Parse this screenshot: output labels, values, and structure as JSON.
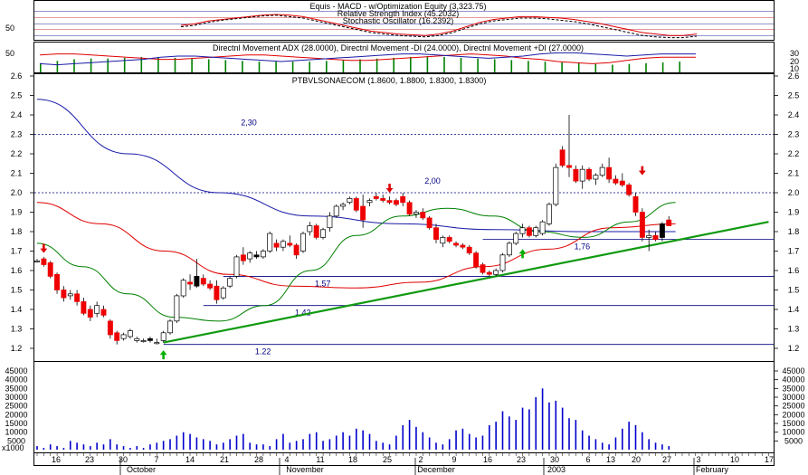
{
  "colors": {
    "frame": "#000000",
    "grid": "#b0b0b0",
    "up": "#ffffff",
    "down": "#ee0000",
    "black_candle": "#000000",
    "blue": "#000080",
    "blue_line": "#1a1aa8",
    "red": "#e00000",
    "green": "#008000",
    "trend_green": "#109a10",
    "volume": "#0000cc",
    "arrow_red": "#e00000",
    "arrow_green": "#00b000"
  },
  "panel_titles": {
    "p1_title1": "Equis - MACD - w/Optimization Equity (3,323.75)",
    "p1_title2": "Relative Strength Index (45.2032)",
    "p1_title3": "Stochastic Oscillator (16.2392)",
    "p2_title": "Directnl Movement ADX (28.0000), Directnl Movement -DI (24.0000), Directnl Movement +DI (27.0000)",
    "p3_title": "PTBVLSONAECOM (1.8600, 1.8800, 1.8300, 1.8300)"
  },
  "chart_data": [
    {
      "type": "line",
      "name_in_chart": "oscillators",
      "left_ticks": [
        "50"
      ],
      "series": [
        {
          "name": "Relative Strength Index",
          "style": "solid-red",
          "values": [
            50,
            52,
            56,
            58,
            60,
            62,
            64,
            65,
            64,
            62,
            58,
            54,
            50,
            46,
            42,
            40,
            38,
            37,
            36,
            38,
            42,
            48,
            54,
            58,
            60,
            62,
            62,
            61,
            60,
            58,
            55,
            52,
            48,
            44,
            40,
            38,
            36,
            36,
            38
          ]
        },
        {
          "name": "Stochastic Oscillator",
          "style": "dashed-black",
          "values": [
            48,
            50,
            54,
            57,
            59,
            61,
            63,
            64,
            62,
            60,
            56,
            52,
            48,
            44,
            40,
            38,
            36,
            35,
            34,
            36,
            40,
            46,
            52,
            56,
            58,
            60,
            60,
            59,
            57,
            55,
            52,
            48,
            44,
            40,
            36,
            34,
            33,
            33,
            35
          ]
        }
      ]
    },
    {
      "type": "bar+line",
      "name_in_chart": "directional-movement",
      "left_ticks": [
        "50"
      ],
      "right_ticks": [
        "30",
        "20",
        "10"
      ],
      "adx_bars": [
        12,
        15,
        17,
        18,
        18,
        19,
        20,
        20,
        19,
        18,
        17,
        16,
        15,
        14,
        14,
        14,
        14,
        15,
        16,
        17,
        18,
        19,
        20,
        21,
        20,
        19,
        18,
        17,
        16,
        15,
        14,
        13,
        12,
        11,
        10,
        11,
        12,
        13,
        14
      ],
      "series": [
        {
          "name": "Directnl Movement -DI",
          "values": [
            26,
            27,
            27,
            26,
            25,
            24,
            23,
            22,
            22,
            23,
            24,
            25,
            26,
            26,
            25,
            24,
            23,
            22,
            21,
            21,
            22,
            23,
            24,
            25,
            26,
            27,
            26,
            25,
            23,
            22,
            20,
            19,
            18,
            19,
            21,
            23,
            24,
            24,
            24
          ]
        },
        {
          "name": "Directnl Movement +DI",
          "values": [
            18,
            17,
            18,
            19,
            20,
            21,
            22,
            24,
            25,
            25,
            24,
            23,
            22,
            21,
            20,
            21,
            22,
            23,
            24,
            25,
            26,
            27,
            27,
            26,
            25,
            24,
            23,
            24,
            25,
            27,
            28,
            28,
            27,
            26,
            25,
            26,
            27,
            27,
            27
          ]
        }
      ]
    },
    {
      "type": "candlestick",
      "name_in_chart": "price",
      "ylim": [
        1.15,
        2.62
      ],
      "y_ticks": [
        "1.2",
        "1.3",
        "1.4",
        "1.5",
        "1.6",
        "1.7",
        "1.8",
        "1.9",
        "2.0",
        "2.1",
        "2.2",
        "2.3",
        "2.4",
        "2.5",
        "2.6"
      ],
      "x_ticks": [
        "16",
        "23",
        "30",
        "7",
        "14",
        "21",
        "28",
        "4",
        "11",
        "18",
        "25",
        "2",
        "9",
        "16",
        "23",
        "30",
        "6",
        "13",
        "20",
        "27",
        "3",
        "10",
        "17"
      ],
      "month_labels": [
        "October",
        "November",
        "December",
        "2003",
        "February"
      ],
      "candles": [
        [
          1.65,
          1.66,
          1.64,
          1.65
        ],
        [
          1.66,
          1.67,
          1.62,
          1.63
        ],
        [
          1.64,
          1.65,
          1.56,
          1.57
        ],
        [
          1.58,
          1.59,
          1.48,
          1.5
        ],
        [
          1.5,
          1.52,
          1.44,
          1.46
        ],
        [
          1.47,
          1.5,
          1.45,
          1.48
        ],
        [
          1.48,
          1.5,
          1.42,
          1.44
        ],
        [
          1.44,
          1.46,
          1.37,
          1.38
        ],
        [
          1.4,
          1.42,
          1.34,
          1.36
        ],
        [
          1.38,
          1.44,
          1.36,
          1.42
        ],
        [
          1.4,
          1.42,
          1.36,
          1.37
        ],
        [
          1.34,
          1.35,
          1.25,
          1.27
        ],
        [
          1.28,
          1.29,
          1.22,
          1.24
        ],
        [
          1.25,
          1.28,
          1.24,
          1.27
        ],
        [
          1.26,
          1.3,
          1.25,
          1.29
        ],
        [
          1.24,
          1.26,
          1.23,
          1.25
        ],
        [
          1.24,
          1.25,
          1.23,
          1.24
        ],
        [
          1.25,
          1.26,
          1.23,
          1.24
        ],
        [
          1.23,
          1.25,
          1.22,
          1.23
        ],
        [
          1.24,
          1.29,
          1.23,
          1.28
        ],
        [
          1.28,
          1.35,
          1.27,
          1.34
        ],
        [
          1.34,
          1.48,
          1.33,
          1.47
        ],
        [
          1.47,
          1.56,
          1.46,
          1.55
        ],
        [
          1.54,
          1.58,
          1.5,
          1.53
        ],
        [
          1.52,
          1.66,
          1.51,
          1.57
        ],
        [
          1.56,
          1.58,
          1.52,
          1.53
        ],
        [
          1.53,
          1.55,
          1.5,
          1.51
        ],
        [
          1.52,
          1.55,
          1.43,
          1.45
        ],
        [
          1.46,
          1.52,
          1.45,
          1.51
        ],
        [
          1.52,
          1.57,
          1.51,
          1.56
        ],
        [
          1.57,
          1.68,
          1.56,
          1.67
        ],
        [
          1.68,
          1.72,
          1.63,
          1.65
        ],
        [
          1.66,
          1.7,
          1.64,
          1.69
        ],
        [
          1.68,
          1.7,
          1.66,
          1.67
        ],
        [
          1.67,
          1.71,
          1.66,
          1.7
        ],
        [
          1.7,
          1.8,
          1.69,
          1.79
        ],
        [
          1.74,
          1.76,
          1.7,
          1.72
        ],
        [
          1.72,
          1.76,
          1.7,
          1.75
        ],
        [
          1.74,
          1.78,
          1.72,
          1.73
        ],
        [
          1.73,
          1.74,
          1.66,
          1.68
        ],
        [
          1.7,
          1.8,
          1.69,
          1.79
        ],
        [
          1.8,
          1.85,
          1.78,
          1.83
        ],
        [
          1.83,
          1.84,
          1.76,
          1.77
        ],
        [
          1.77,
          1.82,
          1.76,
          1.81
        ],
        [
          1.82,
          1.9,
          1.8,
          1.88
        ],
        [
          1.88,
          1.94,
          1.87,
          1.93
        ],
        [
          1.93,
          1.95,
          1.91,
          1.94
        ],
        [
          1.95,
          1.98,
          1.94,
          1.97
        ],
        [
          1.97,
          1.98,
          1.9,
          1.91
        ],
        [
          1.93,
          1.99,
          1.82,
          1.86
        ],
        [
          1.95,
          1.97,
          1.93,
          1.96
        ],
        [
          1.98,
          2.0,
          1.96,
          1.97
        ],
        [
          1.97,
          1.99,
          1.95,
          1.96
        ],
        [
          1.96,
          1.98,
          1.94,
          1.95
        ],
        [
          1.96,
          1.97,
          1.93,
          1.94
        ],
        [
          1.98,
          2.0,
          1.93,
          1.95
        ],
        [
          1.95,
          1.96,
          1.88,
          1.89
        ],
        [
          1.89,
          1.91,
          1.87,
          1.9
        ],
        [
          1.9,
          1.92,
          1.86,
          1.87
        ],
        [
          1.87,
          1.88,
          1.81,
          1.82
        ],
        [
          1.82,
          1.84,
          1.74,
          1.76
        ],
        [
          1.74,
          1.78,
          1.72,
          1.77
        ],
        [
          1.77,
          1.78,
          1.74,
          1.75
        ],
        [
          1.74,
          1.75,
          1.72,
          1.73
        ],
        [
          1.73,
          1.74,
          1.71,
          1.72
        ],
        [
          1.72,
          1.73,
          1.68,
          1.69
        ],
        [
          1.69,
          1.7,
          1.61,
          1.62
        ],
        [
          1.63,
          1.64,
          1.58,
          1.59
        ],
        [
          1.59,
          1.6,
          1.57,
          1.58
        ],
        [
          1.58,
          1.61,
          1.57,
          1.6
        ],
        [
          1.6,
          1.69,
          1.59,
          1.68
        ],
        [
          1.68,
          1.75,
          1.67,
          1.74
        ],
        [
          1.74,
          1.8,
          1.73,
          1.79
        ],
        [
          1.79,
          1.84,
          1.77,
          1.82
        ],
        [
          1.82,
          1.83,
          1.77,
          1.78
        ],
        [
          1.78,
          1.83,
          1.77,
          1.82
        ],
        [
          1.79,
          1.86,
          1.78,
          1.85
        ],
        [
          1.84,
          1.95,
          1.83,
          1.94
        ],
        [
          1.94,
          2.15,
          1.93,
          2.13
        ],
        [
          2.22,
          2.24,
          2.13,
          2.14
        ],
        [
          2.14,
          2.4,
          2.08,
          2.13
        ],
        [
          2.12,
          2.14,
          2.05,
          2.06
        ],
        [
          2.06,
          2.14,
          2.02,
          2.12
        ],
        [
          2.12,
          2.13,
          2.06,
          2.07
        ],
        [
          2.07,
          2.1,
          2.04,
          2.09
        ],
        [
          2.09,
          2.15,
          2.08,
          2.13
        ],
        [
          2.13,
          2.18,
          2.05,
          2.07
        ],
        [
          2.07,
          2.09,
          2.04,
          2.05
        ],
        [
          2.06,
          2.1,
          2.03,
          2.04
        ],
        [
          2.04,
          2.05,
          1.98,
          1.99
        ],
        [
          1.98,
          2.0,
          1.88,
          1.9
        ],
        [
          1.9,
          1.92,
          1.75,
          1.77
        ],
        [
          1.77,
          1.81,
          1.7,
          1.78
        ],
        [
          1.78,
          1.8,
          1.75,
          1.76
        ],
        [
          1.77,
          1.85,
          1.75,
          1.84
        ],
        [
          1.86,
          1.88,
          1.83,
          1.83
        ]
      ],
      "black_candles": [
        17,
        24,
        33,
        94
      ],
      "moving_averages": [
        {
          "name": "ma-long-blue",
          "color_key": "blue_line",
          "from": 0,
          "to": 96,
          "values": [
            2.48,
            2.2,
            2.0,
            1.88,
            1.84,
            1.81,
            1.8,
            1.8
          ]
        },
        {
          "name": "ma-mid-red",
          "color_key": "red",
          "from": 0,
          "to": 96,
          "values": [
            1.95,
            1.84,
            1.7,
            1.58,
            1.52,
            1.51,
            1.54,
            1.62,
            1.71,
            1.82,
            1.84
          ]
        },
        {
          "name": "ma-short-green",
          "color_key": "green",
          "from": 0,
          "to": 96,
          "values": [
            1.74,
            1.62,
            1.48,
            1.36,
            1.34,
            1.42,
            1.6,
            1.78,
            1.88,
            1.92,
            1.88,
            1.8,
            1.77,
            1.85,
            1.95
          ]
        }
      ],
      "trendline": {
        "from_index": 19,
        "from_value": 1.23,
        "to_index": 110,
        "to_value": 1.85
      },
      "support_lines": [
        {
          "value": 1.22,
          "from": 19,
          "label": "1.22"
        },
        {
          "value": 1.42,
          "from": 25,
          "label": "1,42"
        },
        {
          "value": 1.57,
          "from": 28,
          "label": "1,57"
        },
        {
          "value": 1.76,
          "from": 67,
          "label": "1,76"
        }
      ],
      "resistance_lines": [
        {
          "value": 2.3,
          "label": "2,30"
        },
        {
          "value": 2.0,
          "label": "2,00"
        }
      ],
      "arrows": [
        {
          "type": "down",
          "index": 1,
          "value": 1.69,
          "color_key": "arrow_red"
        },
        {
          "type": "down",
          "index": 53,
          "value": 2.0,
          "color_key": "arrow_red"
        },
        {
          "type": "down",
          "index": 91,
          "value": 2.09,
          "color_key": "arrow_red"
        },
        {
          "type": "up",
          "index": 19,
          "value": 1.19,
          "color_key": "arrow_green"
        },
        {
          "type": "up",
          "index": 73,
          "value": 1.71,
          "color_key": "arrow_green"
        }
      ]
    },
    {
      "type": "bar",
      "name_in_chart": "volume",
      "y_ticks": [
        "45000",
        "40000",
        "35000",
        "30000",
        "25000",
        "20000",
        "15000",
        "10000",
        "5000"
      ],
      "y_label": "x1000",
      "values": [
        2,
        1,
        3,
        2,
        1,
        5,
        4,
        3,
        2,
        4,
        3,
        6,
        3,
        2,
        1,
        2,
        1,
        3,
        4,
        5,
        6,
        8,
        10,
        9,
        7,
        6,
        5,
        3,
        4,
        6,
        8,
        9,
        4,
        3,
        3,
        2,
        6,
        9,
        4,
        5,
        6,
        9,
        10,
        5,
        6,
        8,
        10,
        8,
        12,
        11,
        9,
        5,
        4,
        3,
        8,
        14,
        17,
        13,
        10,
        7,
        4,
        3,
        6,
        11,
        12,
        9,
        7,
        8,
        14,
        16,
        22,
        19,
        17,
        24,
        23,
        30,
        35,
        27,
        28,
        24,
        18,
        17,
        11,
        8,
        6,
        4,
        3,
        7,
        12,
        16,
        14,
        10,
        6,
        4,
        3,
        2
      ],
      "volume_scale_max": 45
    }
  ]
}
